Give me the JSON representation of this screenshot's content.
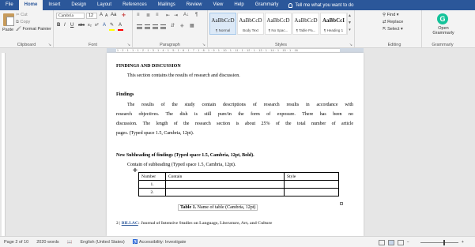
{
  "tabs": [
    "File",
    "Home",
    "Insert",
    "Design",
    "Layout",
    "References",
    "Mailings",
    "Review",
    "View",
    "Help",
    "Grammarly"
  ],
  "active_tab": "Home",
  "tell_me_placeholder": "Tell me what you want to do",
  "clipboard": {
    "paste": "Paste",
    "cut": "Cut",
    "copy": "Copy",
    "format_painter": "Format Painter",
    "label": "Clipboard"
  },
  "font": {
    "name": "Cambria",
    "size": "12",
    "bold": "B",
    "italic": "I",
    "underline": "U",
    "label": "Font",
    "grow": "A",
    "shrink": "A",
    "case": "Aa",
    "strike": "abc",
    "sub": "x₂",
    "sup": "x²"
  },
  "paragraph": {
    "label": "Paragraph",
    "pilcrow": "¶",
    "sort": "A↓"
  },
  "styles": {
    "label": "Styles",
    "items": [
      {
        "sample": "AaBbCcD",
        "name": "¶ Normal"
      },
      {
        "sample": "AaBbCcD",
        "name": "Body Text"
      },
      {
        "sample": "AaBbCcD",
        "name": "¶ No Spac..."
      },
      {
        "sample": "AaBbCcD",
        "name": "¶ Table Pa..."
      },
      {
        "sample": "AaBbCcI",
        "name": "¶ Heading 1"
      }
    ]
  },
  "editing": {
    "find": "Find",
    "replace": "Replace",
    "select": "Select",
    "label": "Editing"
  },
  "grammarly": {
    "logo": "G",
    "open": "Open Grammarly",
    "label": "Grammarly"
  },
  "ruler_ticks": "1 · 2 · 1 · 1 · 1 · 2 · 1 · 3 · 1 · 4 · 1 · 5 · 1 · 6 · 1 · 7 · 1 · 8 · 1 · 9 · 1 · 10 · 1 · 11 · 1 · 12 · 1 · 13 · 1 · 14 · 1 · 15 · 1 · 16",
  "document": {
    "heading": "FINDINGS AND DISCUSSION",
    "intro": "This section contains the results of research and discussion.",
    "subheading": "Findings",
    "para_lines": [
      "The results of the study contain descriptions of research results in accordance with",
      "research objectives. The dish is still pure/in the form of exposure. There has been no",
      "discussion. The length of the research section is about 25% of the total number of article",
      "pages. (Typed space 1.5, Cambria, 12pt)."
    ],
    "subheading2": "New Subheading of findings (Typed space 1.5, Cambria, 12pt, Bold).",
    "sub_intro": "Contain of subheading (Typed space 1.5, Cambria, 12pt).",
    "table": {
      "headers": [
        "Number",
        "Contain",
        "Style"
      ],
      "rows": [
        [
          "1.",
          "",
          ""
        ],
        [
          "2.",
          "",
          ""
        ]
      ]
    },
    "caption_bold": "Table 1.",
    "caption_rest": " Name of table (Cambria, 12pt)",
    "footer_page": "2 |",
    "footer_link": "BILLAC",
    "footer_rest": ": Journal of Intensive Studies on Language, Literature, Art, and Culture"
  },
  "status": {
    "page": "Page 2 of 10",
    "words": "2020 words",
    "language": "English (United States)",
    "accessibility": "Accessibility: Investigate"
  },
  "zoom_level": 0.6
}
